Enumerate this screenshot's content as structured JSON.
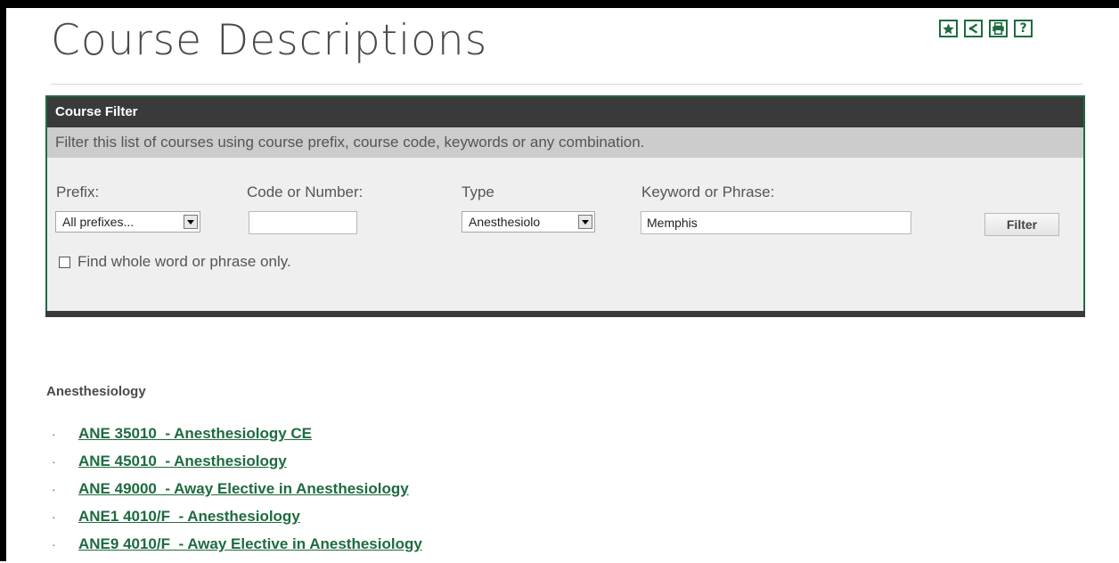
{
  "page": {
    "title": "Course Descriptions"
  },
  "toolbar": {
    "icons": [
      "star-icon",
      "share-icon",
      "print-icon",
      "help-icon"
    ],
    "help_glyph": "?"
  },
  "filter": {
    "header": "Course Filter",
    "description": "Filter this list of courses using course prefix, course code, keywords or any combination.",
    "prefix_label": "Prefix:",
    "prefix_value": "All prefixes...",
    "code_label": "Code or Number:",
    "code_value": "",
    "type_label": "Type",
    "type_value": "Anesthesiolo",
    "keyword_label": "Keyword or Phrase:",
    "keyword_value": "Memphis",
    "button_label": "Filter",
    "whole_word_label": "Find whole word or phrase only.",
    "whole_word_checked": false
  },
  "results": {
    "heading": "Anesthesiology",
    "bullet": "·",
    "courses": [
      "ANE 35010  - Anesthesiology CE",
      "ANE 45010  - Anesthesiology",
      "ANE 49000  - Away Elective in Anesthesiology",
      "ANE1 4010/F  - Anesthesiology",
      "ANE9 4010/F  - Away Elective in Anesthesiology"
    ]
  },
  "colors": {
    "accent": "#1e6b3f",
    "header_bg": "#3a3a3a",
    "description_bg": "#cccccc",
    "panel_bg": "#efefef"
  }
}
